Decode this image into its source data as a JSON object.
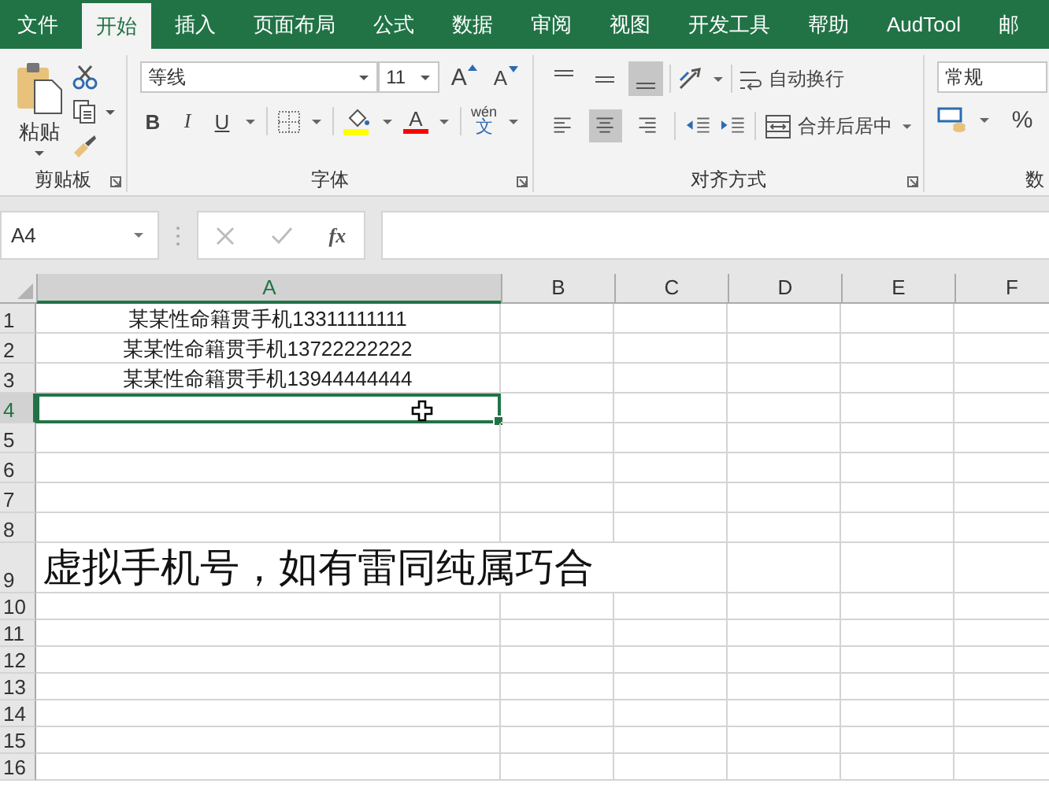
{
  "tabs": [
    {
      "label": "文件",
      "selected": false
    },
    {
      "label": "开始",
      "selected": true
    },
    {
      "label": "插入",
      "selected": false
    },
    {
      "label": "页面布局",
      "selected": false
    },
    {
      "label": "公式",
      "selected": false
    },
    {
      "label": "数据",
      "selected": false
    },
    {
      "label": "审阅",
      "selected": false
    },
    {
      "label": "视图",
      "selected": false
    },
    {
      "label": "开发工具",
      "selected": false
    },
    {
      "label": "帮助",
      "selected": false
    },
    {
      "label": "AudTool",
      "selected": false
    },
    {
      "label": "邮",
      "selected": false
    }
  ],
  "ribbon": {
    "clipboard": {
      "paste": "粘贴",
      "group": "剪贴板"
    },
    "font": {
      "name": "等线",
      "size": "11",
      "grow": "A",
      "shrink": "A",
      "bold": "B",
      "italic": "I",
      "underline": "U",
      "color_letter": "A",
      "phonetic_top": "wén",
      "phonetic_bottom": "文",
      "group": "字体"
    },
    "alignment": {
      "vertical": [
        {
          "kind": "top",
          "selected": false
        },
        {
          "kind": "middle",
          "selected": false
        },
        {
          "kind": "bottom",
          "selected": true
        }
      ],
      "horizontal": [
        {
          "kind": "left",
          "selected": false
        },
        {
          "kind": "center",
          "selected": true
        },
        {
          "kind": "right",
          "selected": false
        }
      ],
      "wrap": "自动换行",
      "merge": "合并后居中",
      "group": "对齐方式"
    },
    "number": {
      "format": "常规",
      "percent": "%",
      "group": "数"
    }
  },
  "formula_bar": {
    "name_box": "A4",
    "fx": "fx"
  },
  "sheet": {
    "columns": [
      {
        "label": "A",
        "selected": true
      },
      {
        "label": "B",
        "selected": false
      },
      {
        "label": "C",
        "selected": false
      },
      {
        "label": "D",
        "selected": false
      },
      {
        "label": "E",
        "selected": false
      },
      {
        "label": "F",
        "selected": false
      }
    ],
    "rows": [
      {
        "header": "1",
        "kind": "normal",
        "selected": false,
        "text": "某某性命籍贯手机13311111111"
      },
      {
        "header": "2",
        "kind": "normal",
        "selected": false,
        "text": "某某性命籍贯手机13722222222"
      },
      {
        "header": "3",
        "kind": "normal",
        "selected": false,
        "text": "某某性命籍贯手机13944444444"
      },
      {
        "header": "4",
        "kind": "normal",
        "selected": true
      },
      {
        "header": "5",
        "kind": "normal",
        "selected": false
      },
      {
        "header": "6",
        "kind": "normal",
        "selected": false
      },
      {
        "header": "7",
        "kind": "normal",
        "selected": false
      },
      {
        "header": "8",
        "kind": "normal",
        "selected": false
      },
      {
        "header": "9",
        "kind": "tall",
        "selected": false,
        "text": "虚拟手机号，如有雷同纯属巧合"
      },
      {
        "header": "10",
        "kind": "short",
        "selected": false
      },
      {
        "header": "11",
        "kind": "short",
        "selected": false
      },
      {
        "header": "12",
        "kind": "short",
        "selected": false
      },
      {
        "header": "13",
        "kind": "short",
        "selected": false
      },
      {
        "header": "14",
        "kind": "short",
        "selected": false
      },
      {
        "header": "15",
        "kind": "short",
        "selected": false
      },
      {
        "header": "16",
        "kind": "short",
        "selected": false
      }
    ]
  }
}
